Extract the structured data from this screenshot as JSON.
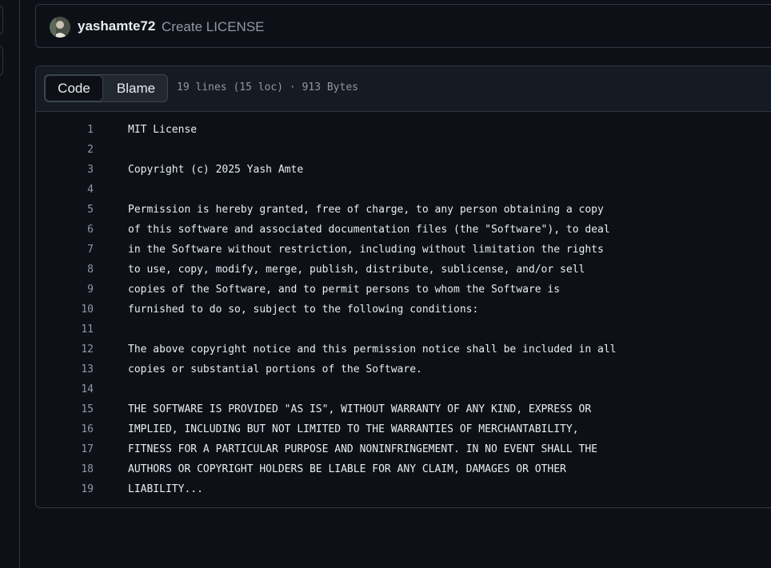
{
  "commit": {
    "author": "yashamte72",
    "message": "Create LICENSE"
  },
  "file_header": {
    "tabs": [
      "Code",
      "Blame"
    ],
    "meta": "19 lines (15 loc) · 913 Bytes"
  },
  "code": {
    "lines": [
      "MIT License",
      "",
      "Copyright (c) 2025 Yash Amte",
      "",
      "Permission is hereby granted, free of charge, to any person obtaining a copy",
      "of this software and associated documentation files (the \"Software\"), to deal",
      "in the Software without restriction, including without limitation the rights",
      "to use, copy, modify, merge, publish, distribute, sublicense, and/or sell",
      "copies of the Software, and to permit persons to whom the Software is",
      "furnished to do so, subject to the following conditions:",
      "",
      "The above copyright notice and this permission notice shall be included in all",
      "copies or substantial portions of the Software.",
      "",
      "THE SOFTWARE IS PROVIDED \"AS IS\", WITHOUT WARRANTY OF ANY KIND, EXPRESS OR",
      "IMPLIED, INCLUDING BUT NOT LIMITED TO THE WARRANTIES OF MERCHANTABILITY,",
      "FITNESS FOR A PARTICULAR PURPOSE AND NONINFRINGEMENT. IN NO EVENT SHALL THE",
      "AUTHORS OR COPYRIGHT HOLDERS BE LIABLE FOR ANY CLAIM, DAMAGES OR OTHER",
      "LIABILITY..."
    ]
  },
  "colors": {
    "background": "#0d1117",
    "border": "#30363d",
    "text": "#e6edf3",
    "muted": "#9198a1",
    "header_bg": "#151b23"
  }
}
